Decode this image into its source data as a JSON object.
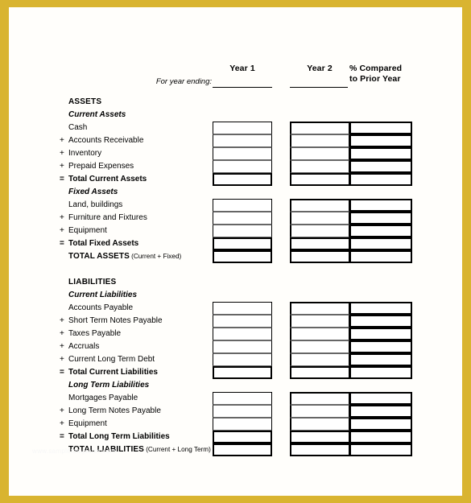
{
  "page": {
    "frame_color": "#d9b430",
    "sheet_color": "#fffefb",
    "watermark": "www.sampletemplates.com"
  },
  "header": {
    "year1": "Year 1",
    "year2": "Year 2",
    "percent_compared": "% Compared",
    "percent_prior": "to Prior Year",
    "year_ending_label": "For year ending:"
  },
  "sections": {
    "assets": {
      "heading": "ASSETS",
      "current": {
        "subheading": "Current Assets",
        "rows": [
          {
            "sign": "",
            "label": "Cash"
          },
          {
            "sign": "+",
            "label": "Accounts Receivable"
          },
          {
            "sign": "+",
            "label": "Inventory"
          },
          {
            "sign": "+",
            "label": "Prepaid Expenses"
          },
          {
            "sign": "=",
            "label": "Total Current Assets"
          }
        ]
      },
      "fixed": {
        "subheading": "Fixed Assets",
        "rows": [
          {
            "sign": "",
            "label": "Land, buildings"
          },
          {
            "sign": "+",
            "label": "Furniture and Fixtures"
          },
          {
            "sign": "+",
            "label": "Equipment"
          },
          {
            "sign": "=",
            "label": "Total Fixed Assets"
          }
        ],
        "grand_total": "TOTAL ASSETS",
        "grand_total_note": "(Current + Fixed)"
      }
    },
    "liabilities": {
      "heading": "LIABILITIES",
      "current": {
        "subheading": "Current Liabilities",
        "rows": [
          {
            "sign": "",
            "label": "Accounts Payable"
          },
          {
            "sign": "+",
            "label": "Short Term Notes Payable"
          },
          {
            "sign": "+",
            "label": "Taxes Payable"
          },
          {
            "sign": "+",
            "label": "Accruals"
          },
          {
            "sign": "+",
            "label": "Current Long Term Debt"
          },
          {
            "sign": "=",
            "label": "Total Current Liabilities"
          }
        ]
      },
      "long_term": {
        "subheading": "Long Term Liabilities",
        "rows": [
          {
            "sign": "",
            "label": "Mortgages Payable"
          },
          {
            "sign": "+",
            "label": "Long Term Notes Payable"
          },
          {
            "sign": "+",
            "label": "Equipment"
          },
          {
            "sign": "=",
            "label": "Total Long Term Liabilities"
          }
        ],
        "grand_total": "TOTAL LIABILITIES",
        "grand_total_note": "(Current + Long Term)"
      }
    }
  }
}
